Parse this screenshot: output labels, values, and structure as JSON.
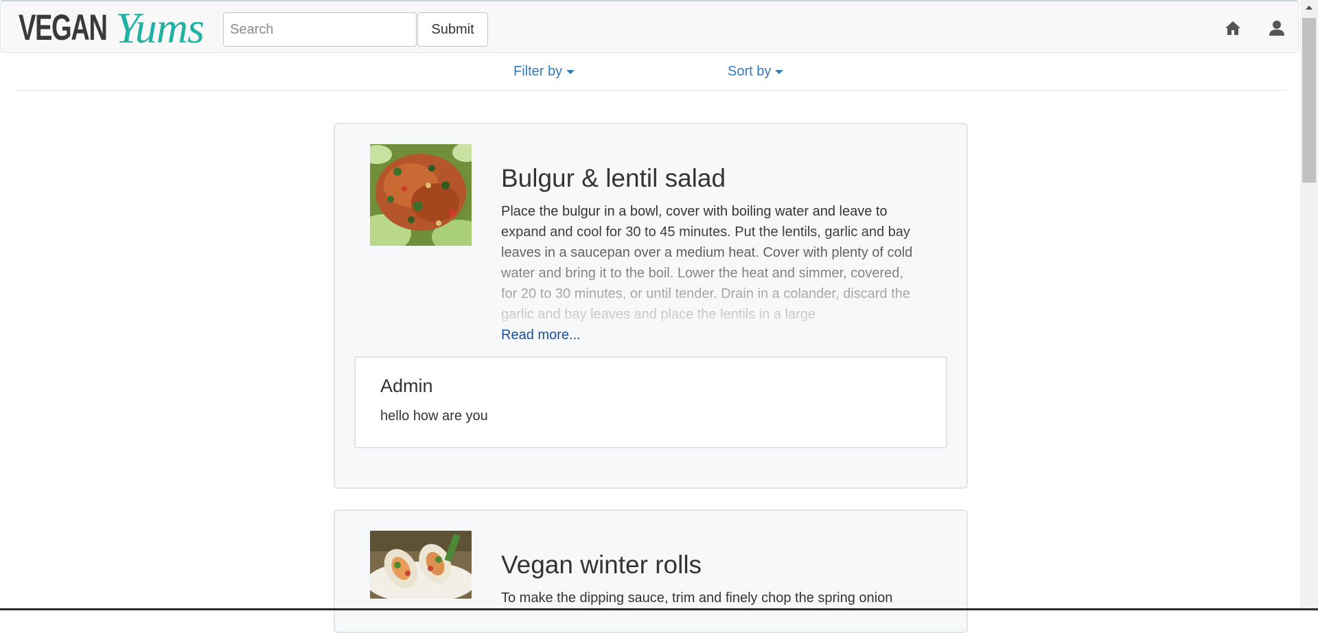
{
  "brand": {
    "part1": "VEGAN",
    "part2": "Yums"
  },
  "search": {
    "placeholder": "Search",
    "submit_label": "Submit"
  },
  "nav_icons": [
    "home-icon",
    "user-icon"
  ],
  "toolbar": {
    "filter_label": "Filter by",
    "sort_label": "Sort by"
  },
  "recipes": [
    {
      "title": "Bulgur & lentil salad",
      "text": "Place the bulgur in a bowl, cover with boiling water and leave to expand and cool for 30 to 45 minutes. Put the lentils, garlic and bay leaves in a saucepan over a medium heat. Cover with plenty of cold water and bring it to the boil. Lower the heat and simmer, covered, for 20 to 30 minutes, or until tender. Drain in a colander, discard the garlic and bay leaves and place the lentils in a large",
      "read_more": "Read more...",
      "comment": {
        "author": "Admin",
        "text": "hello how are you"
      }
    },
    {
      "title": "Vegan winter rolls",
      "text": "To make the dipping sauce, trim and finely chop the spring onion"
    }
  ],
  "colors": {
    "accent": "#337ab7",
    "brand_teal": "#1fb2a4",
    "card_bg": "#f7f8fa"
  }
}
